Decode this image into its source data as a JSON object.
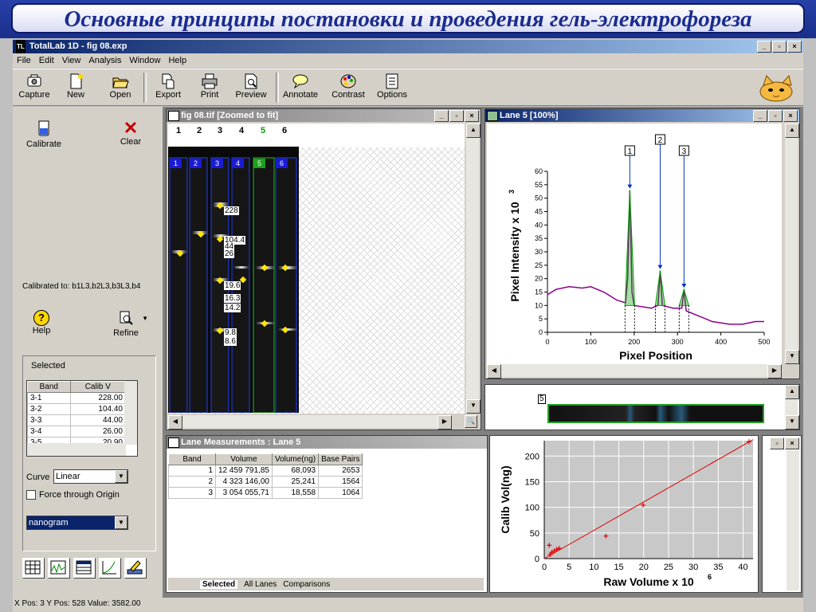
{
  "slide_title": "Основные принципы постановки и проведения гель-электрофореза",
  "app": {
    "title": "TotalLab 1D - fig 08.exp",
    "logo": "TL"
  },
  "window_buttons": {
    "min": "_",
    "restore": "▫",
    "close": "×"
  },
  "menu": [
    "File",
    "Edit",
    "View",
    "Analysis",
    "Window",
    "Help"
  ],
  "toolbar": [
    {
      "label": "Capture",
      "icon": "camera-icon"
    },
    {
      "label": "New",
      "icon": "new-document-icon"
    },
    {
      "label": "Open",
      "icon": "folder-icon"
    },
    {
      "label": "Export",
      "icon": "export-icon"
    },
    {
      "label": "Print",
      "icon": "printer-icon"
    },
    {
      "label": "Preview",
      "icon": "preview-icon"
    },
    {
      "label": "Annotate",
      "icon": "speech-bubble-icon"
    },
    {
      "label": "Contrast",
      "icon": "palette-icon"
    },
    {
      "label": "Options",
      "icon": "options-icon"
    }
  ],
  "left_panel": {
    "calibrate": "Calibrate",
    "clear": "Clear",
    "calibrated_to": "Calibrated to:   b1L3,b2L3,b3L3,b4",
    "help": "Help",
    "refine": "Refine",
    "selected_label": "Selected",
    "band_table": {
      "headers": [
        "Band",
        "Calib V"
      ],
      "rows": [
        [
          "3-1",
          "228.00"
        ],
        [
          "3-2",
          "104.40"
        ],
        [
          "3-3",
          "44.00"
        ],
        [
          "3-4",
          "26.00"
        ],
        [
          "3-5",
          "20.90"
        ]
      ]
    },
    "curve_label": "Curve",
    "curve_value": "Linear",
    "force_label": "Force through Origin",
    "unit_value": "nanogram"
  },
  "gel_window": {
    "title": "fig 08.tif [Zoomed to fit]",
    "lane_numbers": [
      "1",
      "2",
      "3",
      "4",
      "5",
      "6"
    ],
    "lane_headers": [
      "1",
      "2",
      "3",
      "4",
      "5",
      "6"
    ],
    "band_tags": [
      "228",
      "104.4",
      "44",
      "26",
      "19.6",
      "16.3",
      "14.2",
      "9.8",
      "8.6"
    ]
  },
  "lane_window": {
    "title": "Lane 5 [100%]",
    "strip_label": "5"
  },
  "profile_chart": {
    "type": "line",
    "xlabel": "Pixel Position",
    "ylabel": "Pixel Intensity x 10",
    "ylabel_exp": "3",
    "xlim": [
      0,
      500
    ],
    "ylim": [
      0,
      60
    ],
    "xticks": [
      0,
      100,
      200,
      300,
      400,
      500
    ],
    "yticks": [
      0,
      5,
      10,
      15,
      20,
      25,
      30,
      35,
      40,
      45,
      50,
      55,
      60
    ],
    "peaks": [
      {
        "label": "1",
        "x": 190,
        "y": 53
      },
      {
        "label": "2",
        "x": 260,
        "y": 23
      },
      {
        "label": "3",
        "x": 315,
        "y": 16
      }
    ],
    "profile": [
      [
        0,
        14
      ],
      [
        20,
        16
      ],
      [
        50,
        17
      ],
      [
        80,
        16.5
      ],
      [
        100,
        17
      ],
      [
        130,
        15
      ],
      [
        160,
        12
      ],
      [
        180,
        11
      ],
      [
        185,
        20
      ],
      [
        190,
        53
      ],
      [
        195,
        15
      ],
      [
        200,
        10
      ],
      [
        240,
        9
      ],
      [
        255,
        10
      ],
      [
        260,
        23
      ],
      [
        265,
        10
      ],
      [
        290,
        9
      ],
      [
        310,
        9
      ],
      [
        315,
        16
      ],
      [
        320,
        8
      ],
      [
        350,
        6
      ],
      [
        380,
        4
      ],
      [
        420,
        3
      ],
      [
        450,
        3
      ],
      [
        480,
        4
      ],
      [
        500,
        4
      ]
    ]
  },
  "measurements": {
    "title": "Lane Measurements : Lane 5",
    "headers": [
      "Band",
      "Volume",
      "Volume(ng)",
      "Base Pairs"
    ],
    "rows": [
      [
        "1",
        "12 459 791,85",
        "68,093",
        "2653"
      ],
      [
        "2",
        "4 323 146,00",
        "25,241",
        "1564"
      ],
      [
        "3",
        "3 054 055,71",
        "18,558",
        "1064"
      ]
    ],
    "tabs": [
      "Selected",
      "All Lanes",
      "Comparisons"
    ]
  },
  "calib_chart": {
    "type": "scatter",
    "xlabel": "Raw Volume x 10",
    "xlabel_exp": "6",
    "ylabel": "Calib Vol(ng)",
    "xlim": [
      0,
      42
    ],
    "ylim": [
      0,
      230
    ],
    "xticks": [
      0,
      5,
      10,
      15,
      20,
      25,
      30,
      35,
      40
    ],
    "yticks": [
      0,
      50,
      100,
      150,
      200
    ],
    "points": [
      [
        1.0,
        26
      ],
      [
        1.2,
        8
      ],
      [
        1.5,
        12
      ],
      [
        2.0,
        15
      ],
      [
        2.5,
        18
      ],
      [
        3.0,
        20
      ],
      [
        12.4,
        44
      ],
      [
        19.9,
        104.4
      ],
      [
        41.2,
        228
      ]
    ],
    "fit_line": [
      [
        0,
        0
      ],
      [
        42,
        232
      ]
    ]
  },
  "status_text": "X Pos: 3 Y Pos: 528 Value: 3582.00",
  "colors": {
    "titlebar": "#0a246a",
    "chrome": "#d4d0c8",
    "series": "#8b008b",
    "peak": "#00a000",
    "fit": "#e00000"
  }
}
